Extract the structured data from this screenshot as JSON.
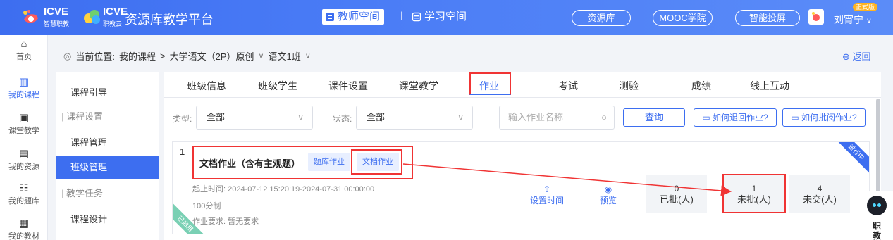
{
  "header": {
    "brand1_name": "ICVE",
    "brand1_sub": "智慧职教",
    "brand2_name": "ICVE",
    "brand2_sub": "职教云",
    "site_title": "资源库教学平台",
    "teacher_space": "教师空间",
    "separator": "|",
    "study_space": "学习空间",
    "pills": [
      "资源库",
      "MOOC学院",
      "智能投屏"
    ],
    "user_role": "正式版",
    "user_name": "刘宵宁"
  },
  "leftnav": {
    "items": [
      {
        "label": "首页",
        "icon": "home-icon"
      },
      {
        "label": "我的课程",
        "icon": "book-icon"
      },
      {
        "label": "课堂教学",
        "icon": "play-icon"
      },
      {
        "label": "我的资源",
        "icon": "resource-icon"
      },
      {
        "label": "我的题库",
        "icon": "question-bank-icon"
      },
      {
        "label": "我的教材",
        "icon": "textbook-icon"
      }
    ]
  },
  "breadcrumb": {
    "prefix": "当前位置:",
    "path1": "我的课程",
    "sep": ">",
    "path2": "大学语文（2P）原创",
    "chevron": "∨",
    "path3": "语文1班",
    "back": "返回"
  },
  "coursemenu": {
    "items": [
      "课程引导",
      "课程设置",
      "课程管理",
      "班级管理",
      "教学任务",
      "课程设计"
    ]
  },
  "tabs": [
    "班级信息",
    "班级学生",
    "课件设置",
    "课堂教学",
    "作业",
    "考试",
    "测验",
    "成绩",
    "线上互动"
  ],
  "filters": {
    "type_label": "类型:",
    "type_value": "全部",
    "status_label": "状态:",
    "status_value": "全部",
    "search_placeholder": "输入作业名称",
    "query": "查询",
    "help_return": "如何退回作业?",
    "help_review": "如何批阅作业?"
  },
  "assignment": {
    "index": "1",
    "title": "文档作业（含有主观题）",
    "tag1": "题库作业",
    "tag2": "文档作业",
    "time": "起止时间: 2024-07-12 15:20:19-2024-07-31 00:00:00",
    "score_system": "100分制",
    "requirement": "作业要求: 暂无要求",
    "action_set_time": "设置时间",
    "action_preview": "预览",
    "stats": [
      {
        "num": "0",
        "label": "已批(人)"
      },
      {
        "num": "1",
        "label": "未批(人)"
      },
      {
        "num": "4",
        "label": "未交(人)"
      }
    ],
    "corner_status": "进行中",
    "corner_used": "已启用"
  },
  "assistant": {
    "label": "职教"
  },
  "colors": {
    "primary": "#3d6ef0",
    "highlight": "#f03434",
    "stat_bg": "#f2f4f7"
  }
}
